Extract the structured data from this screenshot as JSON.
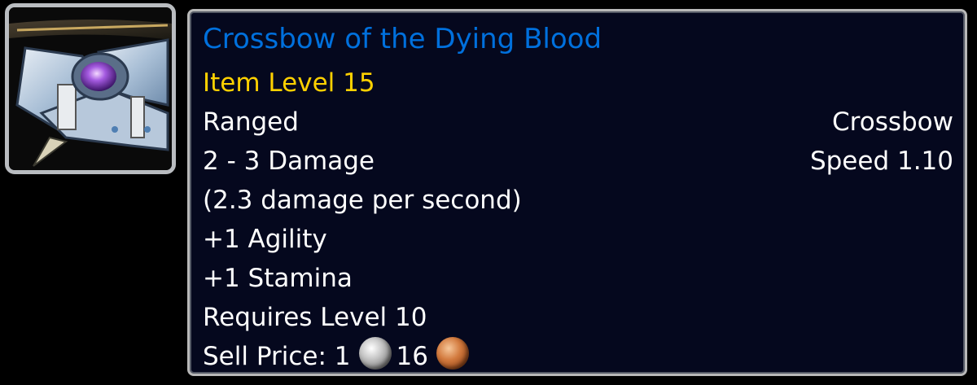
{
  "item": {
    "icon": "crossbow-icon",
    "name": "Crossbow of the Dying Blood",
    "item_level": "Item Level 15",
    "slot": "Ranged",
    "type": "Crossbow",
    "damage": "2 - 3 Damage",
    "speed": "Speed 1.10",
    "dps": "(2.3 damage per second)",
    "stats": [
      "+1 Agility",
      "+1 Stamina"
    ],
    "requirement": "Requires Level 10",
    "sell_price": {
      "label": "Sell Price:",
      "silver": "1",
      "copper": "16"
    }
  },
  "colors": {
    "name_quality": "#0070dd",
    "item_level": "#ffd100",
    "text": "#ffffff",
    "background": "#05081e"
  }
}
